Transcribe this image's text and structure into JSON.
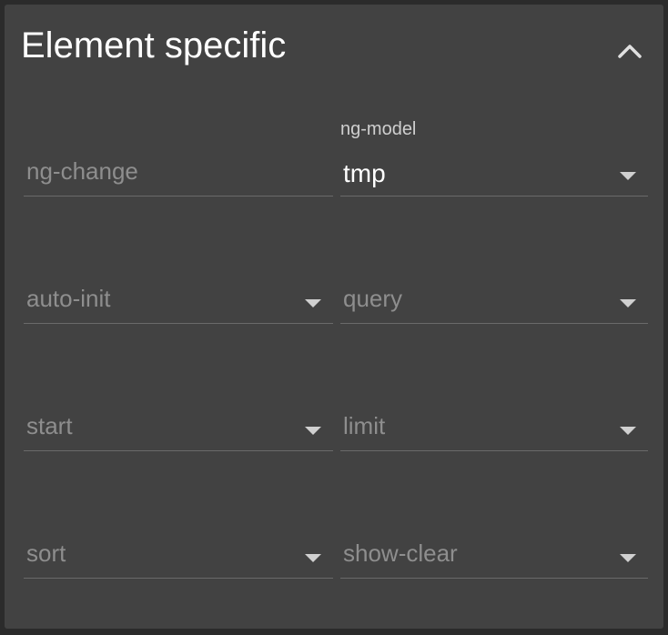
{
  "section": {
    "title": "Element specific",
    "collapse_icon": "chevron-up-icon"
  },
  "fields": {
    "ng_change": {
      "placeholder": "ng-change"
    },
    "ng_model": {
      "label": "ng-model",
      "value": "tmp"
    },
    "auto_init": {
      "placeholder": "auto-init"
    },
    "query": {
      "placeholder": "query"
    },
    "start": {
      "placeholder": "start"
    },
    "limit": {
      "placeholder": "limit"
    },
    "sort": {
      "placeholder": "sort"
    },
    "show_clear": {
      "placeholder": "show-clear"
    }
  },
  "colors": {
    "panel_bg": "#424242",
    "page_bg": "#2b2b2b",
    "title": "#ffffff",
    "placeholder": "#8e8e8e",
    "underline": "#6a6a6a"
  }
}
